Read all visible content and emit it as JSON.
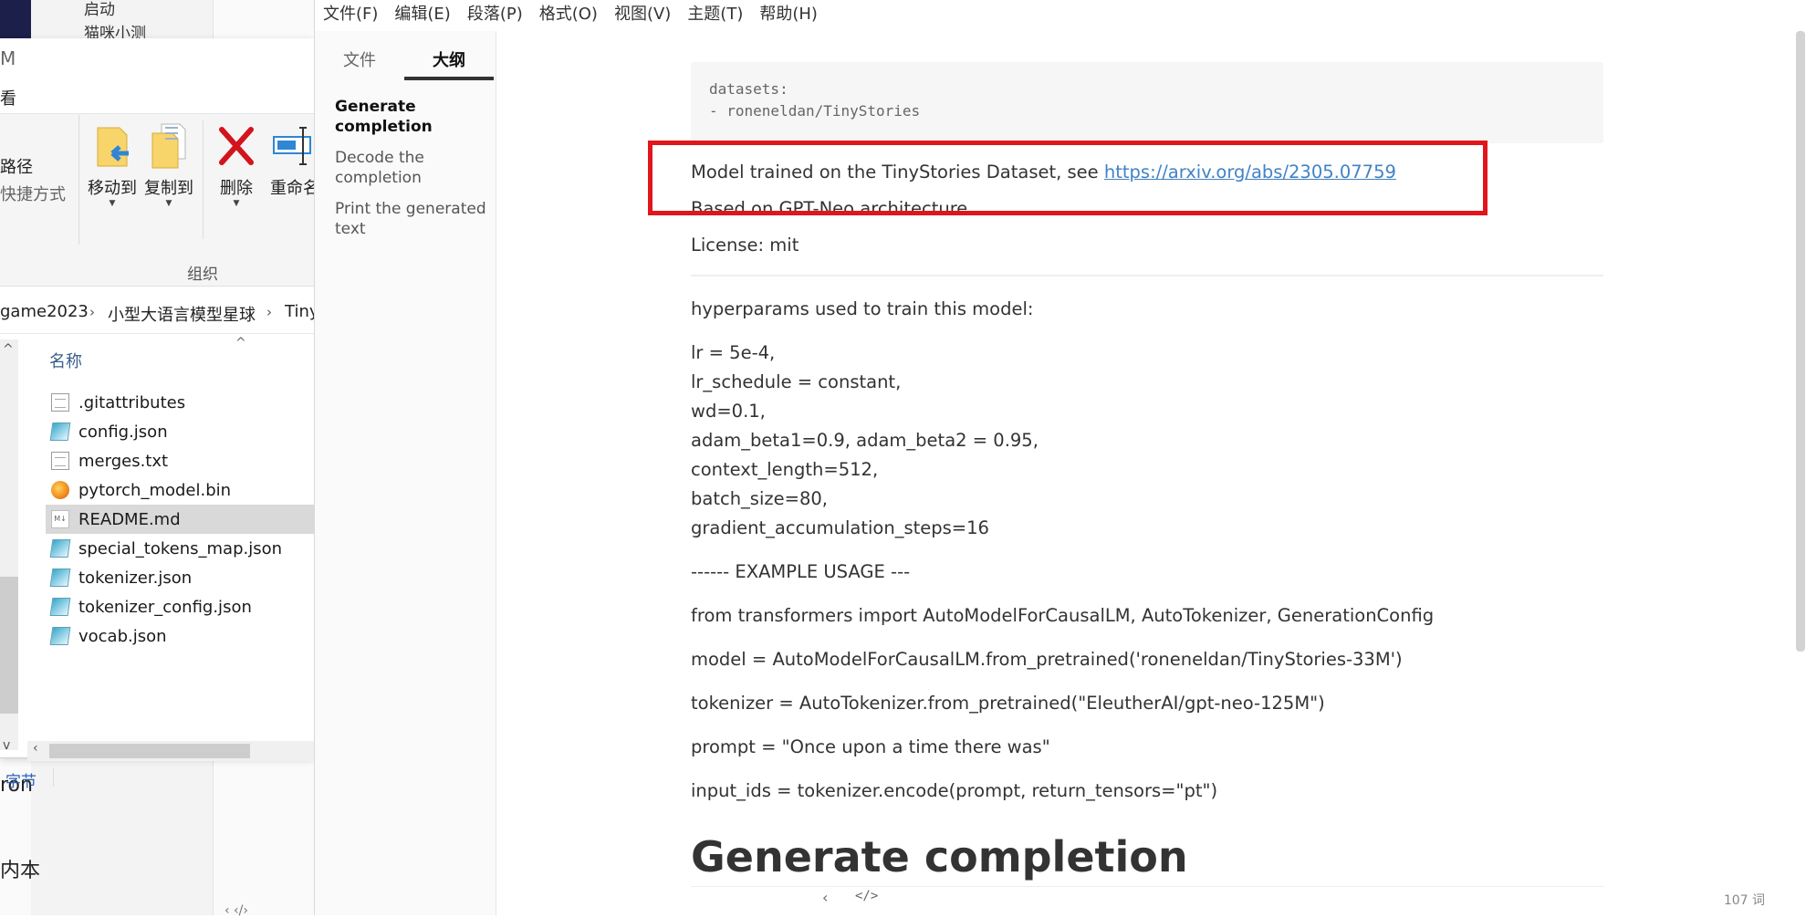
{
  "background_window": {
    "launch_label": "启动",
    "cat_label": "猫咪小测",
    "text_ron": "ron",
    "text_neiben": "内本",
    "bottom_icons": "‹  ‹/›"
  },
  "explorer": {
    "title_fragment": "M",
    "tab_fragment": "看",
    "ribbon": {
      "path_label": "路径",
      "shortcut_label": "快捷方式",
      "move_to": "移动到",
      "copy_to": "复制到",
      "delete": "删除",
      "rename": "重命名",
      "group_label": "组织"
    },
    "breadcrumb": [
      "game2023",
      "小型大语言模型星球",
      "Tiny"
    ],
    "column_header": "名称",
    "files": [
      {
        "name": ".gitattributes",
        "icon": "document-icon"
      },
      {
        "name": "config.json",
        "icon": "json-file-icon"
      },
      {
        "name": "merges.txt",
        "icon": "document-icon"
      },
      {
        "name": "pytorch_model.bin",
        "icon": "bin-file-icon"
      },
      {
        "name": "README.md",
        "icon": "markdown-file-icon"
      },
      {
        "name": "special_tokens_map.json",
        "icon": "json-file-icon"
      },
      {
        "name": "tokenizer.json",
        "icon": "json-file-icon"
      },
      {
        "name": "tokenizer_config.json",
        "icon": "json-file-icon"
      },
      {
        "name": "vocab.json",
        "icon": "json-file-icon"
      }
    ],
    "selected_file": "README.md",
    "status_text": "字节"
  },
  "typora": {
    "menu": [
      "文件(F)",
      "编辑(E)",
      "段落(P)",
      "格式(O)",
      "视图(V)",
      "主题(T)",
      "帮助(H)"
    ],
    "sidebar_tabs": {
      "files": "文件",
      "outline": "大纲"
    },
    "outline": [
      "Generate completion",
      "Decode the completion",
      "Print the generated text"
    ],
    "document": {
      "code_lines": [
        "datasets:",
        "- roneneldan/TinyStories"
      ],
      "model_text": "Model trained on the TinyStories Dataset, see ",
      "model_link": "https://arxiv.org/abs/2305.07759",
      "based_on": "Based on GPT-Neo architecture.",
      "license": "License: mit",
      "hyperparams_intro": "hyperparams used to train this model:",
      "params": [
        "lr = 5e-4,",
        "lr_schedule = constant,",
        "wd=0.1,",
        "adam_beta1=0.9, adam_beta2 = 0.95,",
        "context_length=512,",
        "batch_size=80,",
        "gradient_accumulation_steps=16"
      ],
      "example_usage": "------ EXAMPLE USAGE ---",
      "import_line": "from transformers import AutoModelForCausalLM, AutoTokenizer, GenerationConfig",
      "model_load": "model = AutoModelForCausalLM.from_pretrained('roneneldan/TinyStories-33M')",
      "tokenizer_load": "tokenizer = AutoTokenizer.from_pretrained(\"EleutherAI/gpt-neo-125M\")",
      "prompt_line": "prompt = \"Once upon a time there was\"",
      "input_ids_line": "input_ids = tokenizer.encode(prompt, return_tensors=\"pt\")",
      "heading": "Generate completion"
    },
    "footer": {
      "back": "‹",
      "source": "</>",
      "word_count": "107 词"
    }
  },
  "colors": {
    "highlight": "#e0161c",
    "link": "#4183c4",
    "accent_tab": "#333333"
  }
}
